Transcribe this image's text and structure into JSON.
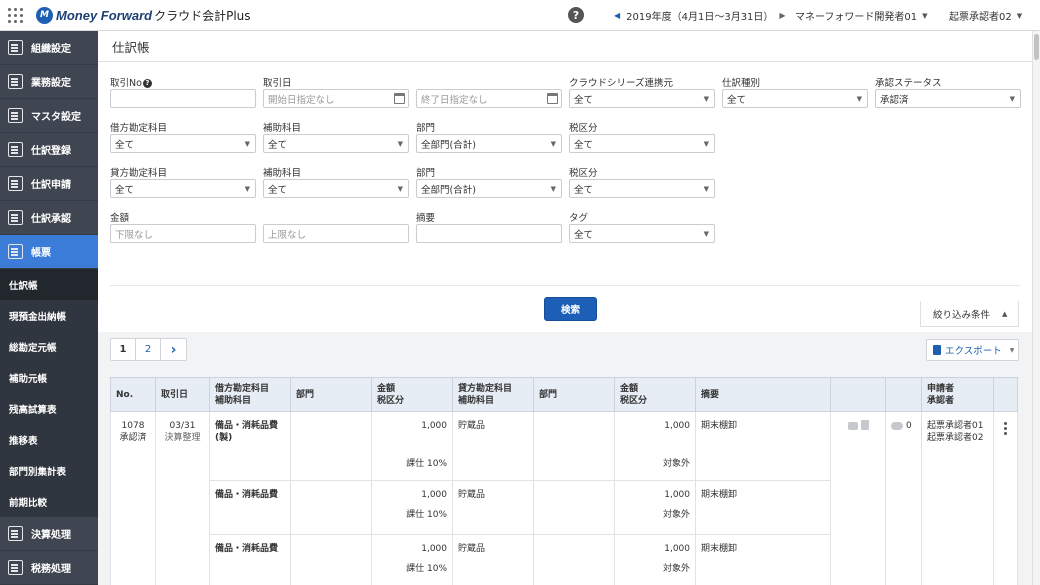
{
  "app": {
    "brand": "Money Forward",
    "product": "クラウド会計Plus",
    "logo_mark": "M"
  },
  "header": {
    "help": "?",
    "fiscal_year": "2019年度（4月1日〜3月31日）",
    "user1": "マネーフォワード開発者01",
    "user2": "起票承認者02"
  },
  "sidebar": {
    "items": [
      {
        "label": "組織設定"
      },
      {
        "label": "業務設定"
      },
      {
        "label": "マスタ設定"
      },
      {
        "label": "仕訳登録"
      },
      {
        "label": "仕訳申請"
      },
      {
        "label": "仕訳承認"
      },
      {
        "label": "帳票"
      }
    ],
    "subitems": [
      {
        "label": "仕訳帳"
      },
      {
        "label": "現預金出納帳"
      },
      {
        "label": "総勘定元帳"
      },
      {
        "label": "補助元帳"
      },
      {
        "label": "残高試算表"
      },
      {
        "label": "推移表"
      },
      {
        "label": "部門別集計表"
      },
      {
        "label": "前期比較"
      }
    ],
    "bottom": [
      {
        "label": "決算処理"
      },
      {
        "label": "税務処理"
      }
    ]
  },
  "page": {
    "title": "仕訳帳"
  },
  "filters": {
    "trade_no": {
      "label": "取引No",
      "help": "?",
      "value": ""
    },
    "trade_date": {
      "label": "取引日",
      "start_placeholder": "開始日指定なし",
      "end_placeholder": "終了日指定なし"
    },
    "cloud_link": {
      "label": "クラウドシリーズ連携元",
      "value": "全て"
    },
    "journal_type": {
      "label": "仕訳種別",
      "value": "全て"
    },
    "approval_status": {
      "label": "承認ステータス",
      "value": "承認済"
    },
    "debit_account": {
      "label": "借方勘定科目",
      "value": "全て"
    },
    "debit_sub": {
      "label": "補助科目",
      "value": "全て"
    },
    "debit_dept": {
      "label": "部門",
      "value": "全部門(合計)"
    },
    "debit_tax": {
      "label": "税区分",
      "value": "全て"
    },
    "credit_account": {
      "label": "貸方勘定科目",
      "value": "全て"
    },
    "credit_sub": {
      "label": "補助科目",
      "value": "全て"
    },
    "credit_dept": {
      "label": "部門",
      "value": "全部門(合計)"
    },
    "credit_tax": {
      "label": "税区分",
      "value": "全て"
    },
    "amount": {
      "label": "金額",
      "min_placeholder": "下限なし",
      "max_placeholder": "上限なし"
    },
    "memo": {
      "label": "摘要",
      "value": ""
    },
    "tag": {
      "label": "タグ",
      "value": "全て"
    },
    "search_label": "検索",
    "narrow_label": "絞り込み条件"
  },
  "pagination": {
    "current": "1",
    "next": "2",
    "next_arrow": "›"
  },
  "export_label": "エクスポート",
  "table": {
    "headers": {
      "no": "No.",
      "date": "取引日",
      "debit_account": "借方勘定科目",
      "debit_sub": "補助科目",
      "debit_dept": "部門",
      "debit_amount": "金額",
      "debit_tax": "税区分",
      "credit_account": "貸方勘定科目",
      "credit_sub": "補助科目",
      "credit_dept": "部門",
      "credit_amount": "金額",
      "credit_tax": "税区分",
      "memo": "摘要",
      "applicant": "申請者",
      "approver": "承認者"
    },
    "entry": {
      "no": "1078",
      "status": "承認済",
      "date": "03/31",
      "date_type": "決算整理",
      "comment_count": "0",
      "applicant": "起票承認者01",
      "approver": "起票承認者02",
      "rows": [
        {
          "debit_account": "備品・消耗品費(製)",
          "debit_amount": "1,000",
          "debit_tax": "課仕 10%",
          "credit_account": "貯蔵品",
          "credit_amount": "1,000",
          "credit_tax": "対象外",
          "memo": "期末棚卸"
        },
        {
          "debit_account": "備品・消耗品費",
          "debit_amount": "1,000",
          "debit_tax": "課仕 10%",
          "credit_account": "貯蔵品",
          "credit_amount": "1,000",
          "credit_tax": "対象外",
          "memo": "期末棚卸"
        },
        {
          "debit_account": "備品・消耗品費",
          "debit_amount": "1,000",
          "debit_tax": "課仕 10%",
          "credit_account": "貯蔵品",
          "credit_amount": "1,000",
          "credit_tax": "対象外",
          "memo": "期末棚卸"
        }
      ]
    }
  }
}
